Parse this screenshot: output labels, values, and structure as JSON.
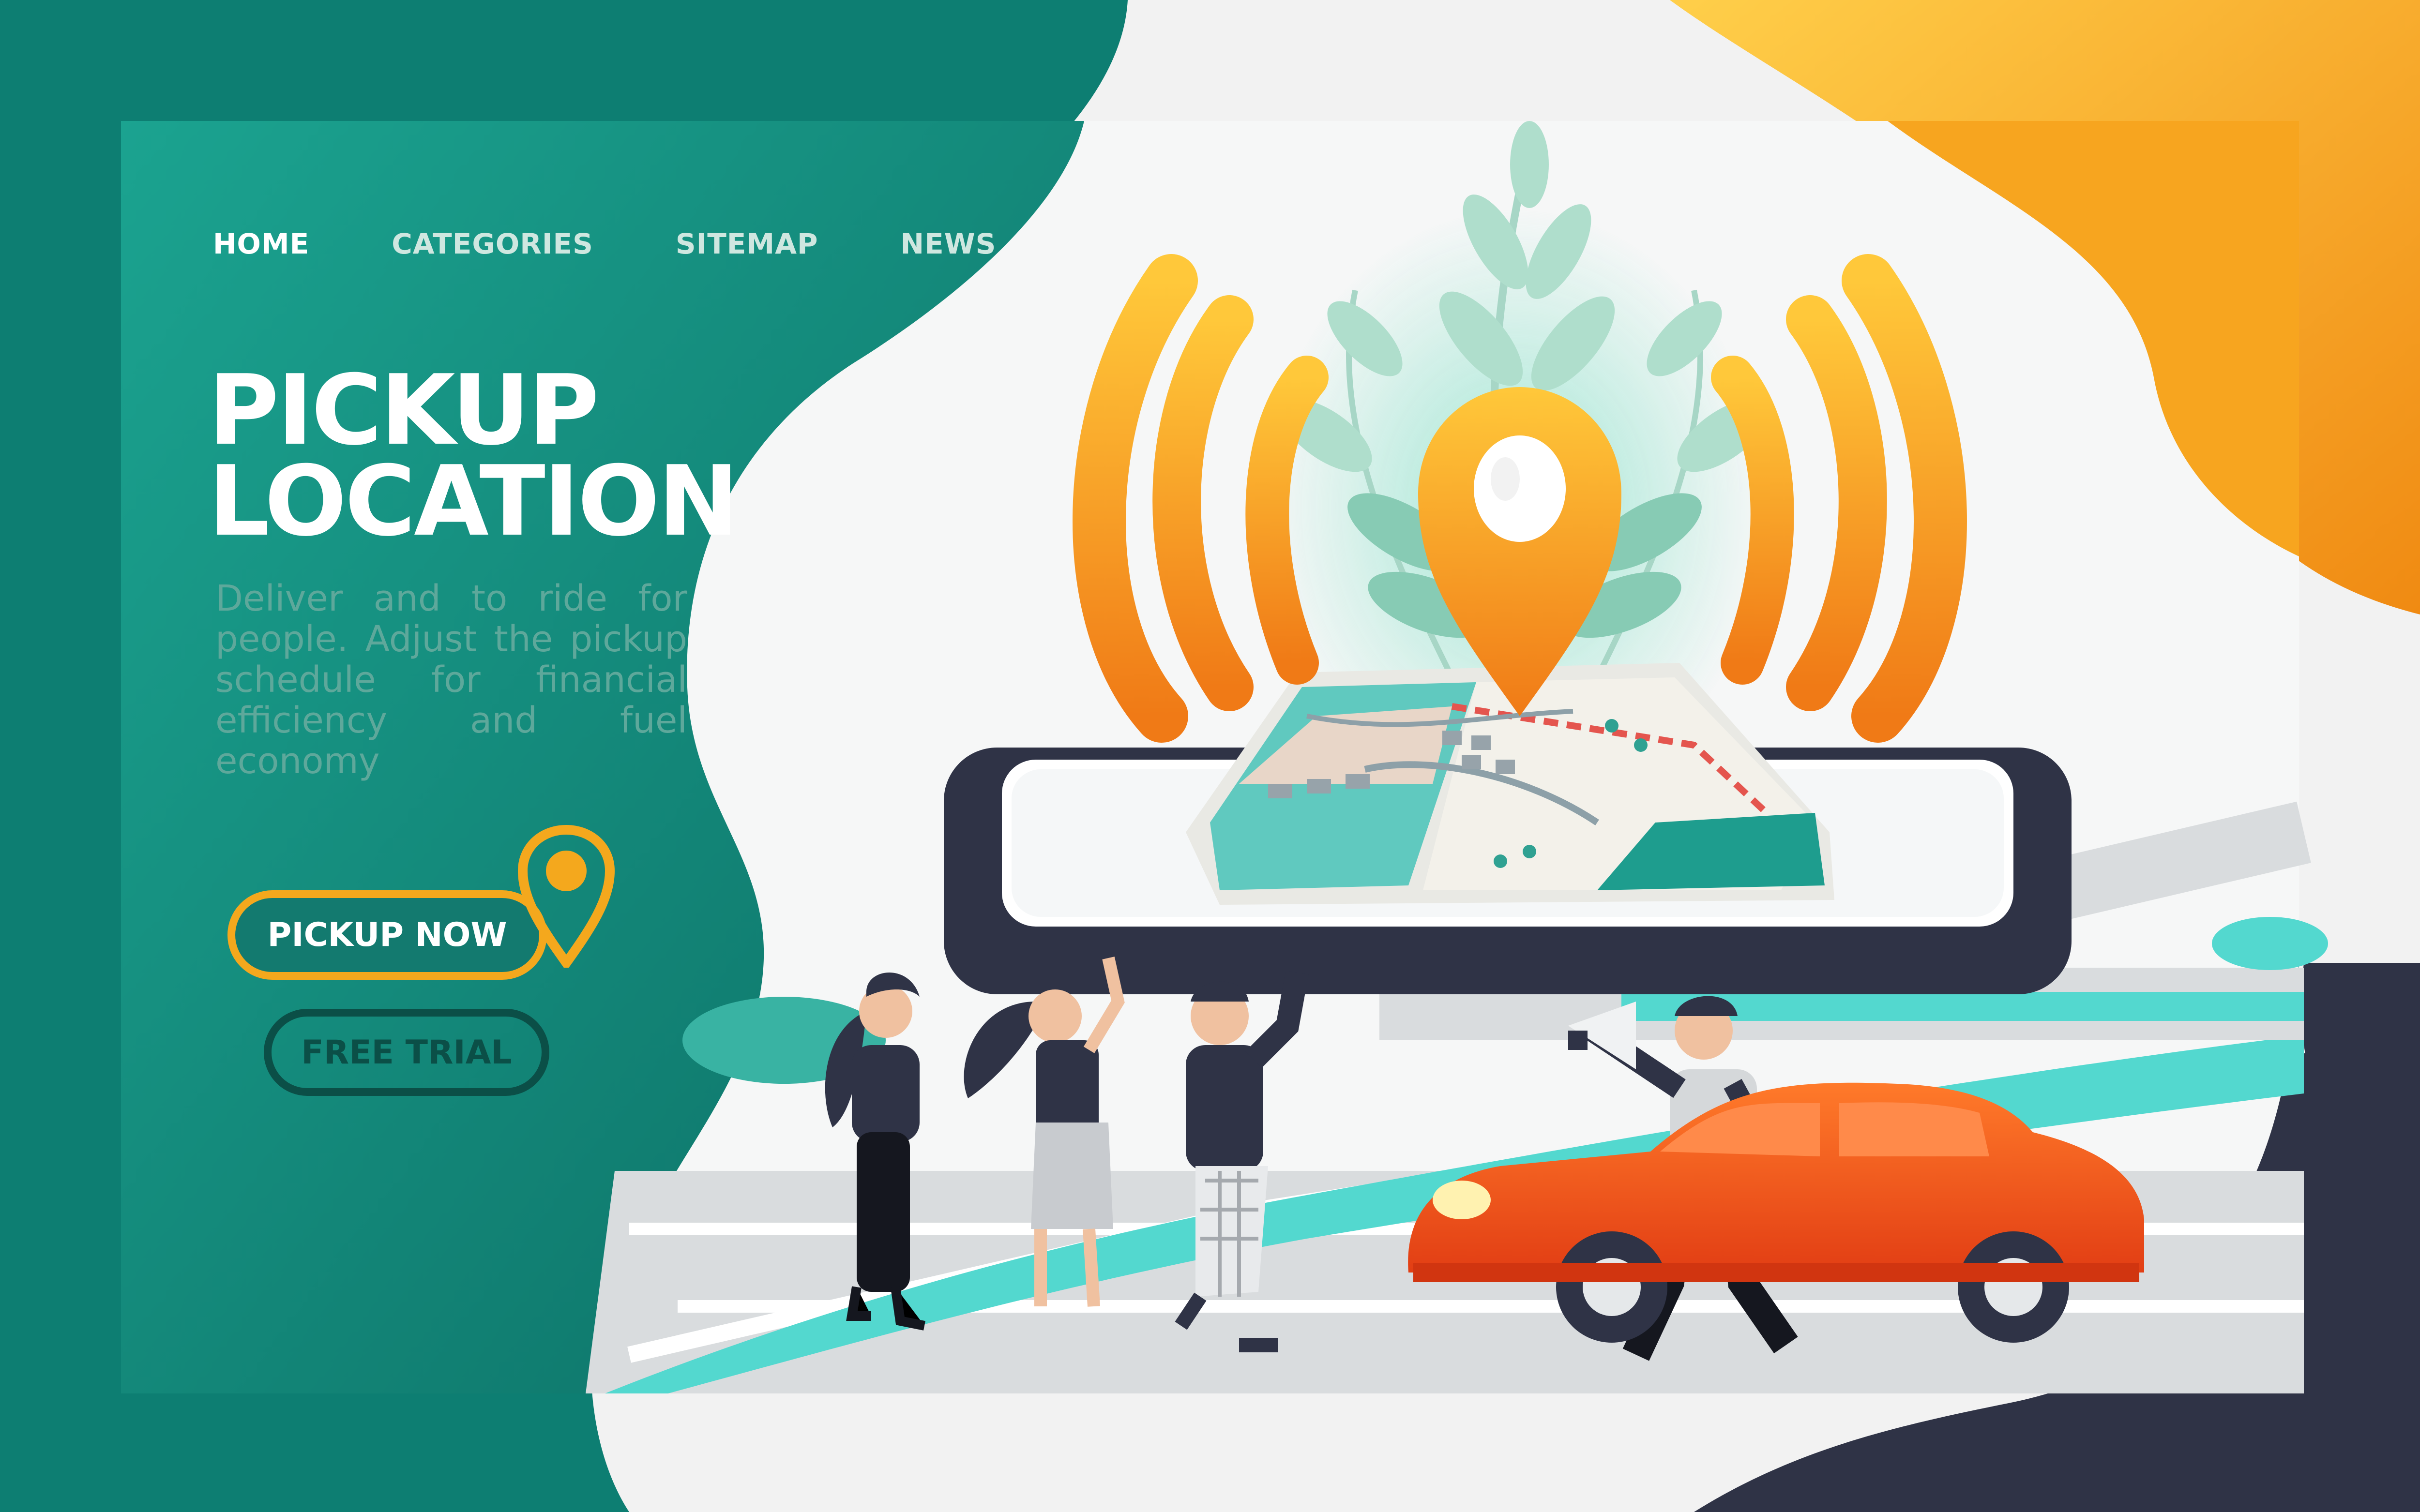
{
  "nav": {
    "items": [
      {
        "label": "HOME",
        "active": true
      },
      {
        "label": "CATEGORIES",
        "active": false
      },
      {
        "label": "SITEMAP",
        "active": false
      },
      {
        "label": "NEWS",
        "active": false
      }
    ]
  },
  "hero": {
    "title_line1": "PICKUP",
    "title_line2": "LOCATION",
    "description": "Deliver and to ride for people. Adjust the pickup schedule for financial efficiency and fuel economy",
    "primary_button": "PICKUP NOW",
    "secondary_button": "FREE TRIAL"
  },
  "colors": {
    "teal_dark": "#0e7a6e",
    "teal_light": "#1ba390",
    "orange": "#f5a623",
    "car_red": "#ea4a1c",
    "navy": "#2f3346",
    "aqua_road": "#53d8cf"
  },
  "icons": {
    "hero_pin": "location-pin-icon",
    "signal": "broadcast-signal-icon",
    "button_pin": "location-pin-icon"
  }
}
